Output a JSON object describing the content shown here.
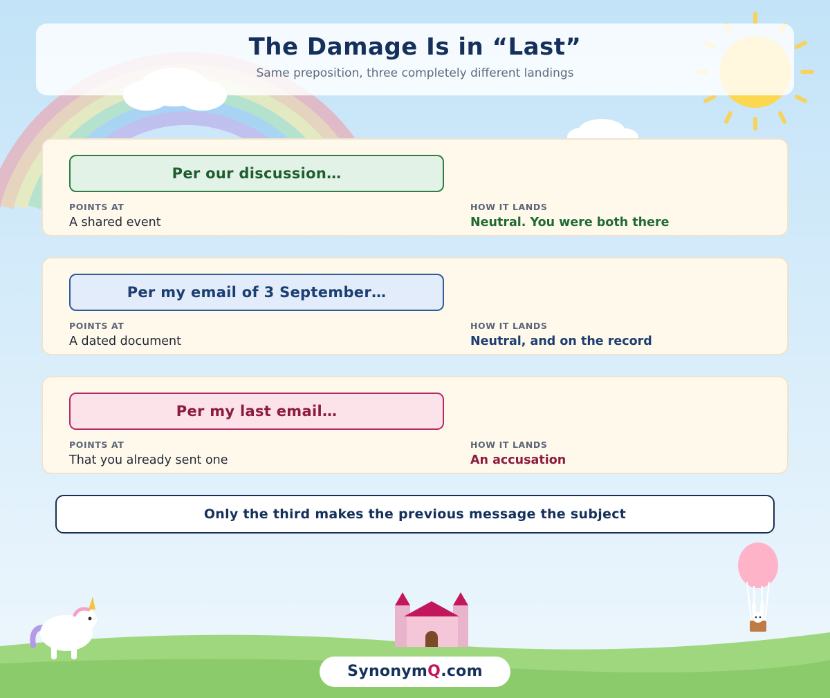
{
  "header": {
    "title": "The Damage Is in “Last”",
    "subtitle": "Same preposition, three completely different landings"
  },
  "cards": [
    {
      "phrase": "Per our discussion…",
      "points_at_label": "POINTS AT",
      "points_at": "A shared event",
      "lands_label": "HOW IT LANDS",
      "lands": "Neutral. You were both there",
      "color": "#1f6a32"
    },
    {
      "phrase": "Per my email of 3 September…",
      "points_at_label": "POINTS AT",
      "points_at": "A dated document",
      "lands_label": "HOW IT LANDS",
      "lands": "Neutral, and on the record",
      "color": "#1c3e70"
    },
    {
      "phrase": "Per my last email…",
      "points_at_label": "POINTS AT",
      "points_at": "That you already sent one",
      "lands_label": "HOW IT LANDS",
      "lands": "An accusation",
      "color": "#8c1c3f"
    }
  ],
  "summary": "Only the third makes the previous message the subject",
  "brand": {
    "prefix": "Synonym",
    "accent": "Q",
    "suffix": ".com"
  },
  "decor_icons": [
    "rainbow-icon",
    "cloud-icon",
    "sun-icon",
    "castle-icon",
    "unicorn-icon",
    "hot-air-balloon-icon",
    "bunny-icon"
  ]
}
